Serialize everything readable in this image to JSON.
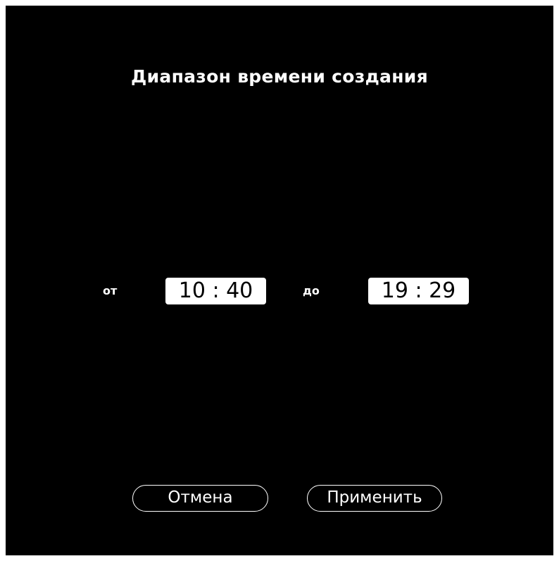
{
  "dialog": {
    "title": "Диапазон времени создания",
    "from_label": "от",
    "from_time": "10 : 40",
    "to_label": "до",
    "to_time": "19 : 29",
    "cancel_label": "Отмена",
    "apply_label": "Применить"
  },
  "colors": {
    "background": "#000000",
    "text": "#ffffff",
    "field_background": "#ffffff",
    "field_text": "#000000"
  }
}
